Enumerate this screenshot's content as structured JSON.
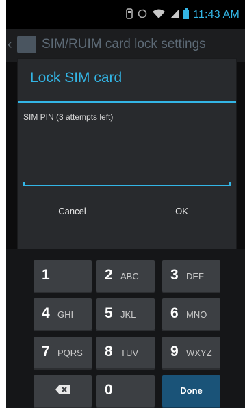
{
  "status_bar": {
    "time": "11:43 AM"
  },
  "action_bar": {
    "title": "SIM/RUIM card lock settings"
  },
  "dialog": {
    "title": "Lock SIM card",
    "field_label": "SIM PIN (3 attempts left)",
    "pin_value": "",
    "cancel_label": "Cancel",
    "ok_label": "OK"
  },
  "keyboard": {
    "keys": [
      {
        "digit": "1",
        "letters": ""
      },
      {
        "digit": "2",
        "letters": "ABC"
      },
      {
        "digit": "3",
        "letters": "DEF"
      },
      {
        "digit": "4",
        "letters": "GHI"
      },
      {
        "digit": "5",
        "letters": "JKL"
      },
      {
        "digit": "6",
        "letters": "MNO"
      },
      {
        "digit": "7",
        "letters": "PQRS"
      },
      {
        "digit": "8",
        "letters": "TUV"
      },
      {
        "digit": "9",
        "letters": "WXYZ"
      },
      {
        "digit": "0",
        "letters": ""
      }
    ],
    "done_label": "Done",
    "backspace_icon": "backspace-icon"
  },
  "colors": {
    "accent": "#33b5e5",
    "done_key": "#1a5378"
  }
}
